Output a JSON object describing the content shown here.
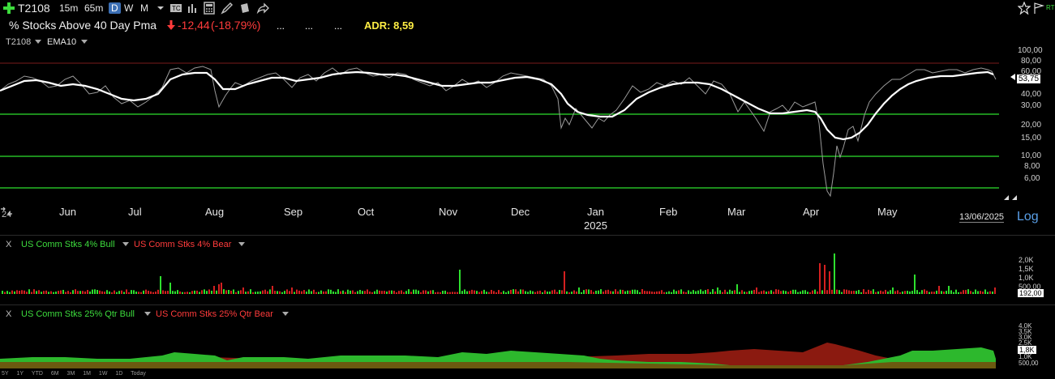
{
  "toolbar": {
    "ticker": "T2108",
    "timeframes": [
      "15m",
      "65m",
      "D",
      "W",
      "M"
    ],
    "active_timeframe": "D"
  },
  "info": {
    "title": "% Stocks Above 40 Day Pma",
    "change": "-12,44",
    "change_pct": "(-18,79%)",
    "dots": [
      "...",
      "...",
      "..."
    ],
    "adr": "ADR: 8,59"
  },
  "main_chart": {
    "legend_symbol": "T2108",
    "legend_indicator": "EMA10",
    "y_ticks": [
      "100,00",
      "80,00",
      "60,00",
      "40,00",
      "30,00",
      "20,00",
      "15,00",
      "10,00",
      "8,00",
      "6,00"
    ],
    "last_value": "53,75",
    "months": [
      "Jun",
      "Jul",
      "Aug",
      "Sep",
      "Oct",
      "Nov",
      "Dec",
      "Jan",
      "Feb",
      "Mar",
      "Apr",
      "May"
    ],
    "year_label": "2025",
    "date_label": "13/06/2025",
    "scale_label": "Log",
    "corner_label": "24",
    "colors": {
      "raw": "#9a9a9a",
      "ema": "#ffffff",
      "upper_line": "#7a1c1c",
      "green_line": "#33cc33",
      "green_line_bright": "#2ee02e"
    }
  },
  "panel2": {
    "close_label": "X",
    "bull_label": "US Comm Stks 4% Bull",
    "bear_label": "US Comm Stks 4% Bear",
    "y_ticks": [
      "2,0K",
      "1,5K",
      "1,0K",
      "500,00"
    ],
    "last_value": "192,00"
  },
  "panel3": {
    "close_label": "X",
    "bull_label": "US Comm Stks 25% Qtr Bull",
    "bear_label": "US Comm Stks 25% Qtr Bear",
    "y_ticks": [
      "4,0K",
      "3,5K",
      "3,0K",
      "2,5K",
      "1,0K",
      "500,00"
    ],
    "last_value": "1,8K"
  },
  "range_bar": [
    "5Y",
    "1Y",
    "YTD",
    "6M",
    "3M",
    "1M",
    "1W",
    "1D",
    "Today"
  ]
}
